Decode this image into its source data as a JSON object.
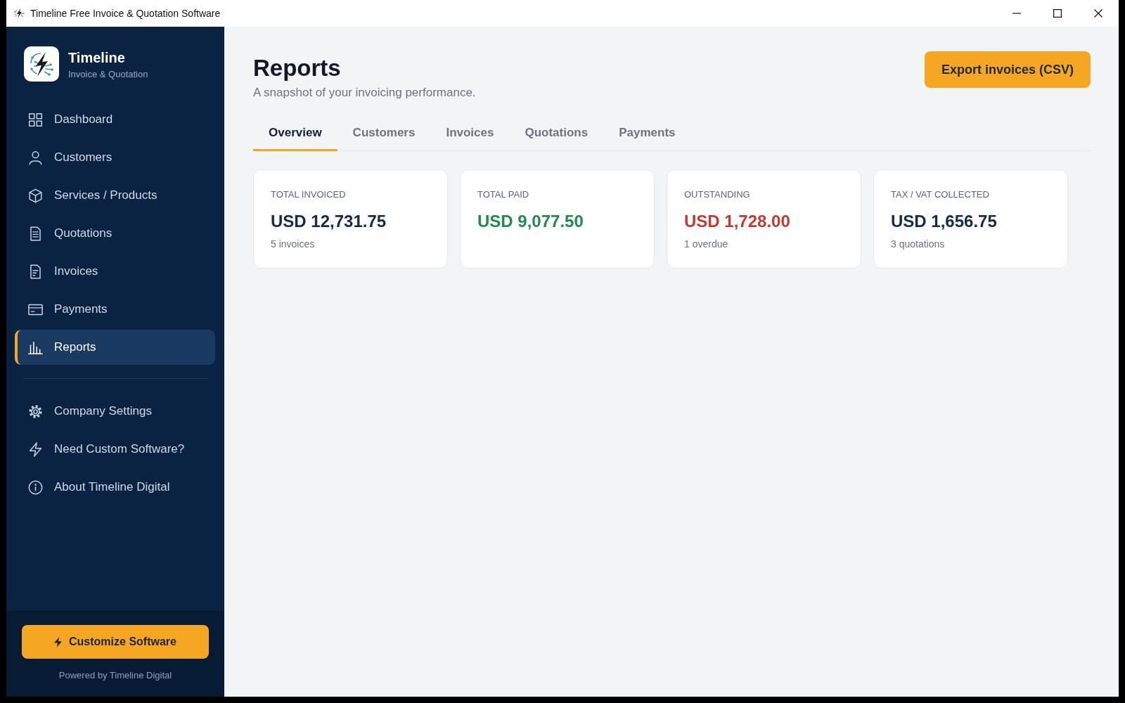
{
  "window": {
    "title": "Timeline Free Invoice & Quotation Software"
  },
  "sidebar": {
    "brand": {
      "name": "Timeline",
      "tagline": "Invoice & Quotation"
    },
    "nav_items": [
      {
        "label": "Dashboard",
        "selected": false
      },
      {
        "label": "Customers",
        "selected": false
      },
      {
        "label": "Services / Products",
        "selected": false
      },
      {
        "label": "Quotations",
        "selected": false
      },
      {
        "label": "Invoices",
        "selected": false
      },
      {
        "label": "Payments",
        "selected": false
      },
      {
        "label": "Reports",
        "selected": true
      }
    ],
    "secondary_items": [
      {
        "label": "Company Settings",
        "selected": false
      },
      {
        "label": "Need Custom Software?",
        "selected": false
      },
      {
        "label": "About Timeline Digital",
        "selected": false
      }
    ],
    "cta_button": "Customize Software",
    "footer_text": "Powered by Timeline Digital"
  },
  "header": {
    "title": "Reports",
    "subtitle": "A snapshot of your invoicing performance.",
    "export_button": "Export invoices (CSV)"
  },
  "tabs": [
    {
      "label": "Overview",
      "selected": true
    },
    {
      "label": "Customers",
      "selected": false
    },
    {
      "label": "Invoices",
      "selected": false
    },
    {
      "label": "Quotations",
      "selected": false
    },
    {
      "label": "Payments",
      "selected": false
    }
  ],
  "stat_cards": [
    {
      "label": "TOTAL INVOICED",
      "value": "USD 12,731.75",
      "note": "5 invoices",
      "color": "#142b4c"
    },
    {
      "label": "TOTAL PAID",
      "value": "USD 9,077.50",
      "color": "#218a4d"
    },
    {
      "label": "OUTSTANDING",
      "value": "USD 1,728.00",
      "note": "1 overdue",
      "color": "#c23b2e"
    },
    {
      "label": "TAX / VAT COLLECTED",
      "value": "USD 1,656.75",
      "note": "3 quotations",
      "color": "#142b4c"
    }
  ]
}
